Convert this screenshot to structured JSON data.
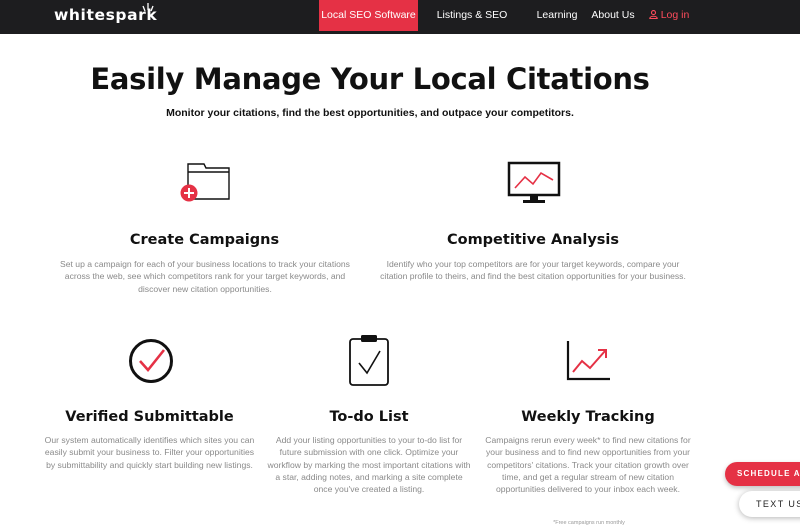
{
  "nav": {
    "logo_text": "whitespark",
    "items": [
      {
        "label": "Local SEO Software",
        "active": true
      },
      {
        "label": "Listings & SEO Services",
        "active": false
      },
      {
        "label": "Learning",
        "active": false
      },
      {
        "label": "About Us",
        "active": false
      }
    ],
    "login_label": "Log in",
    "login_icon": "user-icon"
  },
  "hero": {
    "title": "Easily Manage Your Local Citations",
    "subtitle": "Monitor your citations, find the best opportunities, and outpace your competitors."
  },
  "features": [
    {
      "icon": "folder-add-icon",
      "title": "Create Campaigns",
      "description": "Set up a campaign for each of your business locations to track your citations across the web, see which competitors rank for your target keywords, and discover new citation opportunities."
    },
    {
      "icon": "monitor-chart-icon",
      "title": "Competitive Analysis",
      "description": "Identify who your top competitors are for your target keywords, compare your citation profile to theirs, and find the best citation opportunities for your business."
    },
    {
      "icon": "check-circle-icon",
      "title": "Verified Submittable",
      "description": "Our system automatically identifies which sites you can easily submit your business to. Filter your opportunities by submittability and quickly start building new listings."
    },
    {
      "icon": "clipboard-check-icon",
      "title": "To-do List",
      "description": "Add your listing opportunities to your to-do list for future submission with one click. Optimize your workflow by marking the most important citations with a star, adding notes, and marking a site complete once you've created a listing."
    },
    {
      "icon": "trend-chart-icon",
      "title": "Weekly Tracking",
      "description": "Campaigns rerun every week* to find new citations for your business and to find new opportunities from your competitors' citations. Track your citation growth over time, and get a regular stream of new citation opportunities delivered to your inbox each week."
    }
  ],
  "footnote": "*Free campaigns run monthly",
  "floating": {
    "schedule_label": "SCHEDULE A C",
    "text_label": "TEXT US"
  },
  "colors": {
    "accent": "#e53145",
    "nav_bg": "#1d1d1f",
    "body_text": "#8a8a8a"
  }
}
